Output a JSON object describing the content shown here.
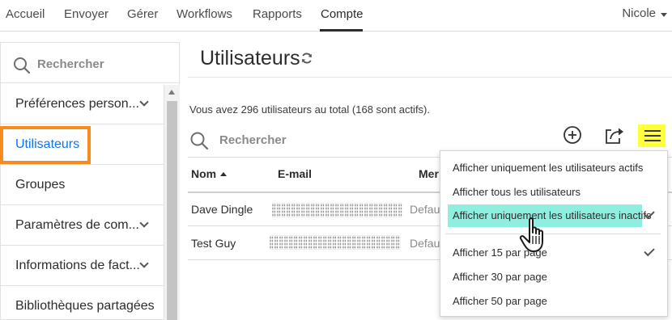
{
  "nav": {
    "tabs": [
      {
        "label": "Accueil"
      },
      {
        "label": "Envoyer"
      },
      {
        "label": "Gérer"
      },
      {
        "label": "Workflows"
      },
      {
        "label": "Rapports"
      },
      {
        "label": "Compte"
      }
    ],
    "active_tab": "Compte",
    "user": "Nicole"
  },
  "sidebar": {
    "search_placeholder": "Rechercher",
    "items": [
      {
        "label": "Préférences person...",
        "expandable": true
      },
      {
        "label": "Utilisateurs",
        "expandable": false,
        "selected": true
      },
      {
        "label": "Groupes",
        "expandable": false
      },
      {
        "label": "Paramètres de com...",
        "expandable": true
      },
      {
        "label": "Informations de fact...",
        "expandable": true
      },
      {
        "label": "Bibliothèques partagées",
        "expandable": false
      }
    ]
  },
  "main": {
    "title": "Utilisateurs",
    "summary": "Vous avez 296 utilisateurs au total (168 sont actifs).",
    "search_placeholder": "Rechercher",
    "columns": [
      "Nom",
      "E-mail",
      "Mer"
    ],
    "rows": [
      {
        "name": "Dave Dingle",
        "email_redacted": true,
        "col3": "Defau"
      },
      {
        "name": "Test Guy",
        "email_redacted": true,
        "col3": "Defau"
      }
    ]
  },
  "menu": {
    "filter_items": [
      {
        "label": "Afficher uniquement les utilisateurs actifs",
        "checked": false
      },
      {
        "label": "Afficher tous les utilisateurs",
        "checked": false
      },
      {
        "label": "Afficher uniquement les utilisateurs inactifs",
        "checked": true,
        "hovered": true
      }
    ],
    "page_items": [
      {
        "label": "Afficher 15 par page",
        "checked": true
      },
      {
        "label": "Afficher 30 par page",
        "checked": false
      },
      {
        "label": "Afficher 50 par page",
        "checked": false
      }
    ]
  },
  "colors": {
    "accent": "#1473e6",
    "highlight_orange": "#f68c1f",
    "menu_highlight": "#8eeee0",
    "menu_button_bg": "#ffff3c"
  },
  "icons": [
    "search-icon",
    "refresh-icon",
    "add-user-icon",
    "export-icon",
    "hamburger-menu-icon",
    "checkmark-icon",
    "chevron-down-icon",
    "hand-cursor-icon"
  ]
}
